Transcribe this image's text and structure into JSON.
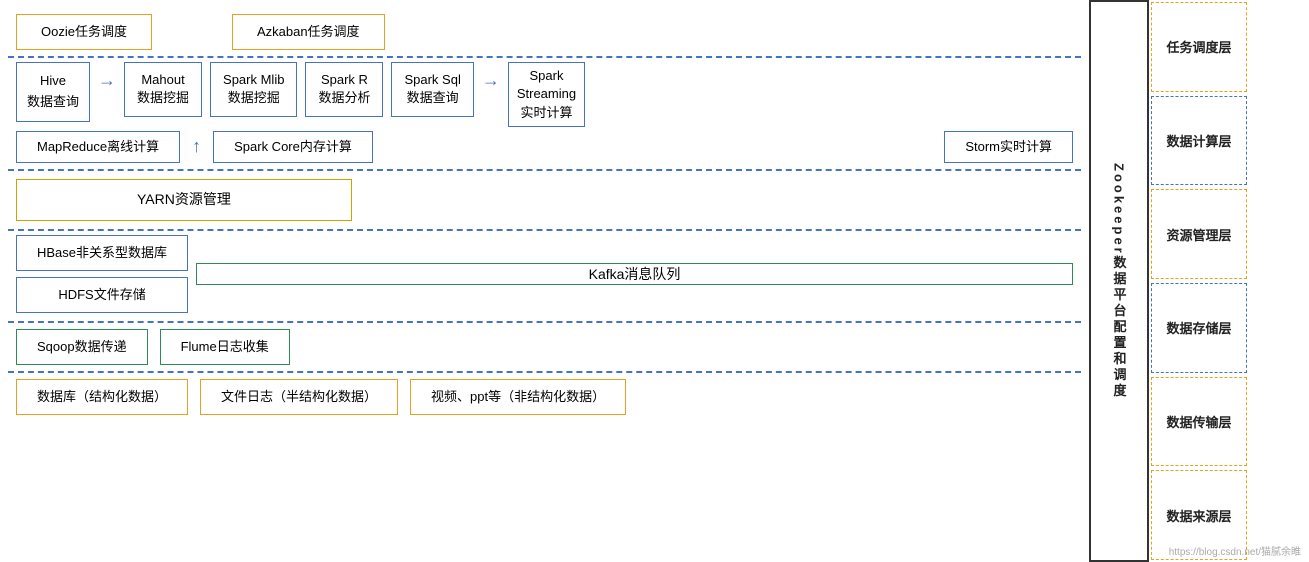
{
  "layers": {
    "task": "任务调度层",
    "compute": "数据计算层",
    "resource": "资源管理层",
    "storage": "数据存储层",
    "transfer": "数据传输层",
    "source": "数据来源层"
  },
  "zookeeper": {
    "label": "Zookeeper数据平台配置和调度"
  },
  "task_row": {
    "oozie": "Oozie任务调度",
    "azkaban": "Azkaban任务调度"
  },
  "compute": {
    "hive": "Hive\n数据查询",
    "mahout": "Mahout\n数据挖掘",
    "spark_mlib": "Spark Mlib\n数据挖掘",
    "spark_r": "Spark R\n数据分析",
    "spark_sql": "Spark Sql\n数据查询",
    "spark_streaming": "Spark\nStreaming\n实时计算",
    "mapreduce": "MapReduce离线计算",
    "spark_core": "Spark Core内存计算",
    "storm": "Storm实时计算"
  },
  "resource": {
    "yarn": "YARN资源管理"
  },
  "storage": {
    "hbase": "HBase非关系型数据库",
    "hdfs": "HDFS文件存储",
    "kafka": "Kafka消息队列"
  },
  "transfer": {
    "sqoop": "Sqoop数据传递",
    "flume": "Flume日志收集"
  },
  "source": {
    "db": "数据库（结构化数据）",
    "log": "文件日志（半结构化数据）",
    "video": "视频、ppt等（非结构化数据）"
  },
  "watermark": "https://blog.csdn.net/猫腻余睢"
}
